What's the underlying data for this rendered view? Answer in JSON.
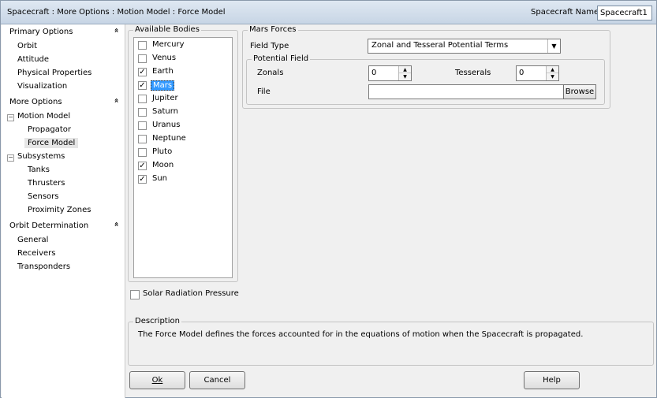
{
  "window": {
    "title": "Spacecraft : More Options : Motion Model : Force Model",
    "spacecraft_name_label": "Spacecraft Name",
    "spacecraft_name_value": "Spacecraft1"
  },
  "sidebar": {
    "primary_header": "Primary Options",
    "primary_items": [
      "Orbit",
      "Attitude",
      "Physical Properties",
      "Visualization"
    ],
    "more_header": "More Options",
    "motion_model": "Motion Model",
    "motion_children": [
      "Propagator",
      "Force Model"
    ],
    "subsystems": "Subsystems",
    "subsystem_children": [
      "Tanks",
      "Thrusters",
      "Sensors",
      "Proximity Zones"
    ],
    "od_header": "Orbit Determination",
    "od_items": [
      "General",
      "Receivers",
      "Transponders"
    ],
    "collapse_glyph": "»",
    "tree_glyph": "−"
  },
  "bodies": {
    "title": "Available Bodies",
    "items": [
      {
        "name": "Mercury",
        "checked": false
      },
      {
        "name": "Venus",
        "checked": false
      },
      {
        "name": "Earth",
        "checked": true
      },
      {
        "name": "Mars",
        "checked": true,
        "selected": true
      },
      {
        "name": "Jupiter",
        "checked": false
      },
      {
        "name": "Saturn",
        "checked": false
      },
      {
        "name": "Uranus",
        "checked": false
      },
      {
        "name": "Neptune",
        "checked": false
      },
      {
        "name": "Pluto",
        "checked": false
      },
      {
        "name": "Moon",
        "checked": true
      },
      {
        "name": "Sun",
        "checked": true
      }
    ],
    "check_glyph": "✓"
  },
  "srp": {
    "label": "Solar Radiation Pressure",
    "checked": false
  },
  "forces": {
    "title": "Mars Forces",
    "field_type_label": "Field Type",
    "field_type_value": "Zonal and Tesseral Potential Terms",
    "potential_title": "Potential Field",
    "zonals_label": "Zonals",
    "zonals_value": "0",
    "tesserals_label": "Tesserals",
    "tesserals_value": "0",
    "file_label": "File",
    "file_value": "",
    "browse_label": "Browse"
  },
  "description": {
    "title": "Description",
    "text": "The Force Model defines the forces accounted for in the equations of motion when the Spacecraft is propagated."
  },
  "buttons": {
    "ok": "Ok",
    "cancel": "Cancel",
    "help": "Help"
  },
  "glyphs": {
    "dropdown": "▼",
    "spin_up": "▲",
    "spin_down": "▼"
  }
}
